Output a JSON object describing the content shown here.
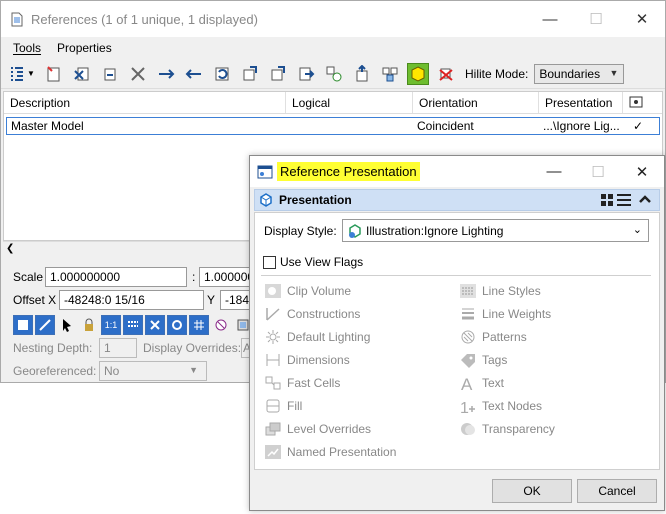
{
  "references_window": {
    "title": "References (1 of 1 unique, 1 displayed)",
    "menu": [
      {
        "label": "Tools",
        "accel": "T"
      },
      {
        "label": "Properties",
        "accel": "P"
      }
    ],
    "hilite_label": "Hilite Mode:",
    "hilite_value": "Boundaries",
    "columns": [
      "Description",
      "Logical",
      "Orientation",
      "Presentation"
    ],
    "row": {
      "description": "Master Model",
      "logical": "",
      "orientation": "Coincident",
      "presentation": "...\\Ignore Lig...",
      "check": "✓"
    },
    "scale_label": "Scale",
    "scale_value1": "1.000000000",
    "scale_sep": ":",
    "scale_value2": "1.000000",
    "offset_label": "Offset X",
    "offset_x": "-48248:0 15/16",
    "offset_y_label": "Y",
    "offset_y": "-1848",
    "nesting_label": "Nesting Depth:",
    "nesting_value": "1",
    "display_overrides_label": "Display Overrides:",
    "display_overrides_value": "A",
    "georef_label": "Georeferenced:",
    "georef_value": "No"
  },
  "dialog": {
    "title": "Reference Presentation",
    "section_title": "Presentation",
    "display_style_label": "Display Style:",
    "display_style_value": "Illustration:Ignore Lighting",
    "use_view_flags": "Use View Flags",
    "left_options": [
      "Clip Volume",
      "Constructions",
      "Default Lighting",
      "Dimensions",
      "Fast Cells",
      "Fill",
      "Level Overrides",
      "Named Presentation"
    ],
    "right_options": [
      "Line Styles",
      "Line Weights",
      "Patterns",
      "Tags",
      "Text",
      "Text Nodes",
      "Transparency"
    ],
    "ok_label": "OK",
    "cancel_label": "Cancel"
  },
  "colors": {
    "highlight_yellow": "#ffff33",
    "active_green": "#6ebd2f",
    "selection_blue": "#3c7fd6",
    "section_header": "#cfe0f5"
  }
}
